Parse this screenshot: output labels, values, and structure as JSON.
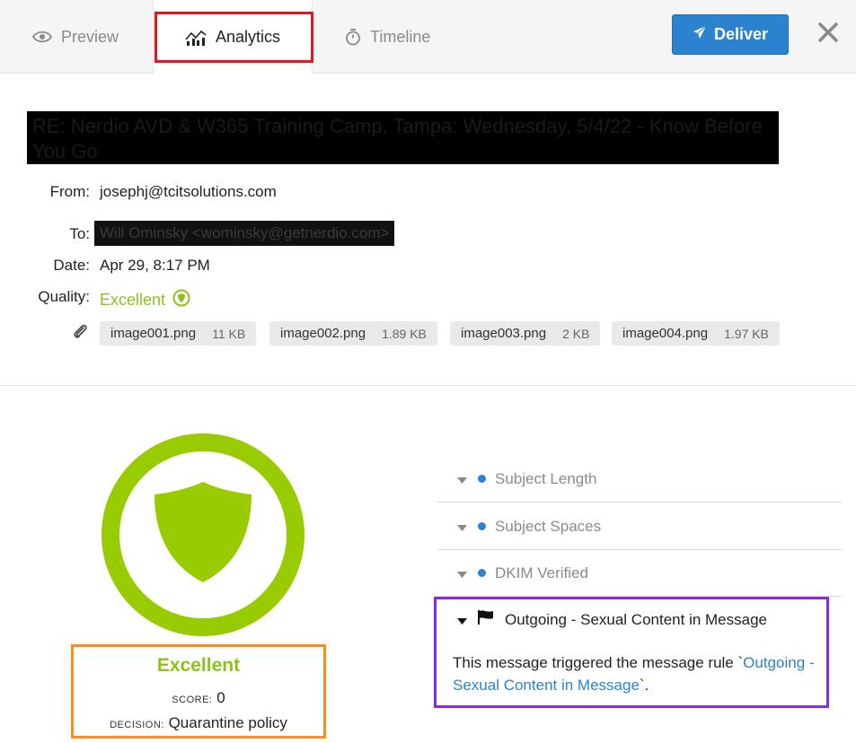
{
  "tabs": {
    "preview": "Preview",
    "analytics": "Analytics",
    "timeline": "Timeline"
  },
  "toolbar": {
    "deliver_label": "Deliver"
  },
  "message": {
    "subject": "RE: Nerdio AVD & W365 Training Camp, Tampa: Wednesday, 5/4/22 - Know Before You Go",
    "from_label": "From:",
    "from": "josephj@tcitsolutions.com",
    "to_label": "To:",
    "to": "Will Ominsky <wominsky@getnerdio.com>",
    "date_label": "Date:",
    "date": "Apr 29, 8:17 PM",
    "quality_label": "Quality:",
    "quality": "Excellent",
    "attachments": [
      {
        "name": "image001.png",
        "size": "11 KB"
      },
      {
        "name": "image002.png",
        "size": "1.89 KB"
      },
      {
        "name": "image003.png",
        "size": "2 KB"
      },
      {
        "name": "image004.png",
        "size": "1.97 KB"
      }
    ]
  },
  "score_card": {
    "title": "Excellent",
    "score_label": "SCORE:",
    "score": "0",
    "decision_label": "DECISION:",
    "decision": "Quarantine policy"
  },
  "rules": [
    {
      "label": "Subject Length"
    },
    {
      "label": "Subject Spaces"
    },
    {
      "label": "DKIM Verified"
    }
  ],
  "triggered_rule": {
    "title": "Outgoing - Sexual Content in Message",
    "body_prefix": "This message triggered the message rule `",
    "link_text": "Outgoing - Sexual Content in Message",
    "body_suffix": "`."
  },
  "colors": {
    "accent_blue": "#2b83d0",
    "quality_green": "#99cc00",
    "highlight_red": "#e8131b",
    "highlight_orange": "#ff8c1a",
    "highlight_purple": "#8a2be2"
  }
}
